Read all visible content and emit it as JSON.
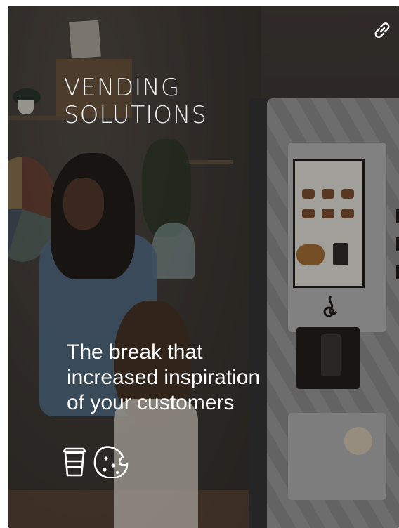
{
  "card": {
    "title_lines": [
      "VENDING",
      "SOLUTIONS"
    ],
    "tagline_lines": [
      "The break that",
      "increased inspiration",
      "of your customers"
    ],
    "icons": [
      "coffee-cup-icon",
      "cookie-icon"
    ],
    "link_icon": "link-icon"
  },
  "colors": {
    "text": "#ffffff",
    "overlay": "#1e1a18"
  }
}
